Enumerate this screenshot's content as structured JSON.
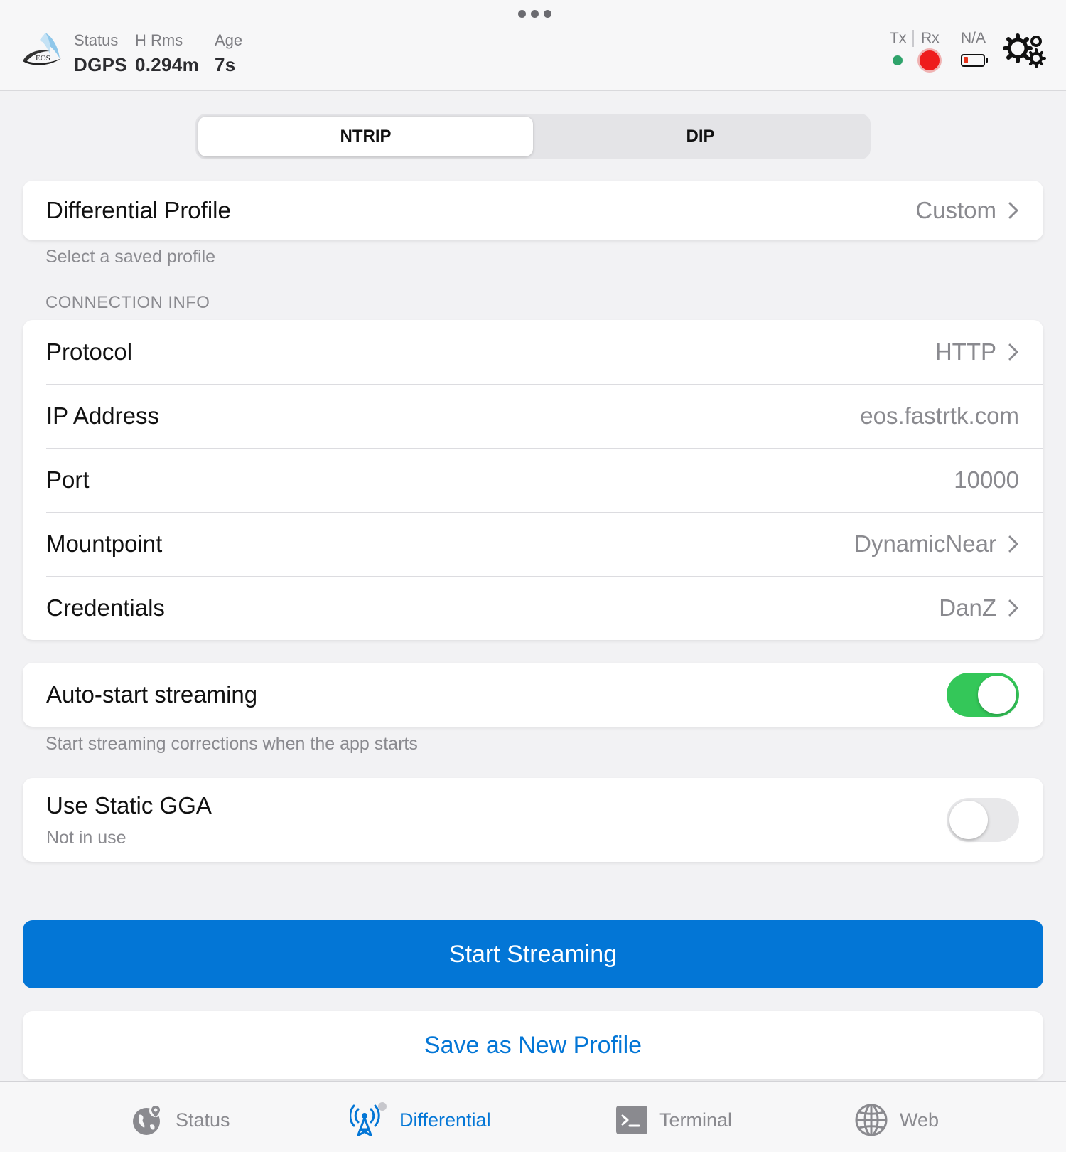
{
  "header": {
    "status_label": "Status",
    "status_value": "DGPS",
    "hrms_label": "H Rms",
    "hrms_value": "0.294m",
    "age_label": "Age",
    "age_value": "7s",
    "tx_label": "Tx",
    "rx_label": "Rx",
    "battery_label": "N/A",
    "logo_text": "EOS",
    "colors": {
      "tx": "#2fa36b",
      "rx": "#ee1c1c",
      "battery_low": "#e5331b"
    }
  },
  "segment": {
    "tabs": [
      {
        "label": "NTRIP",
        "active": true
      },
      {
        "label": "DIP",
        "active": false
      }
    ]
  },
  "profile": {
    "label": "Differential Profile",
    "value": "Custom",
    "caption": "Select a saved profile"
  },
  "connection": {
    "section_title": "CONNECTION INFO",
    "rows": [
      {
        "label": "Protocol",
        "value": "HTTP"
      },
      {
        "label": "IP Address",
        "value": "eos.fastrtk.com"
      },
      {
        "label": "Port",
        "value": "10000"
      },
      {
        "label": "Mountpoint",
        "value": "DynamicNear"
      },
      {
        "label": "Credentials",
        "value": "DanZ"
      }
    ]
  },
  "autostart": {
    "label": "Auto-start streaming",
    "enabled": true,
    "caption": "Start streaming corrections when the app starts"
  },
  "static_gga": {
    "label": "Use Static GGA",
    "sublabel": "Not in use",
    "enabled": false
  },
  "actions": {
    "start_label": "Start Streaming",
    "save_label": "Save as New Profile"
  },
  "tabbar": {
    "items": [
      {
        "label": "Status",
        "icon": "globe-pin-icon",
        "active": false
      },
      {
        "label": "Differential",
        "icon": "antenna-icon",
        "active": true
      },
      {
        "label": "Terminal",
        "icon": "terminal-icon",
        "active": false
      },
      {
        "label": "Web",
        "icon": "globe-icon",
        "active": false
      }
    ]
  },
  "theme": {
    "accent": "#0376d6",
    "toggle_on": "#34c759"
  }
}
